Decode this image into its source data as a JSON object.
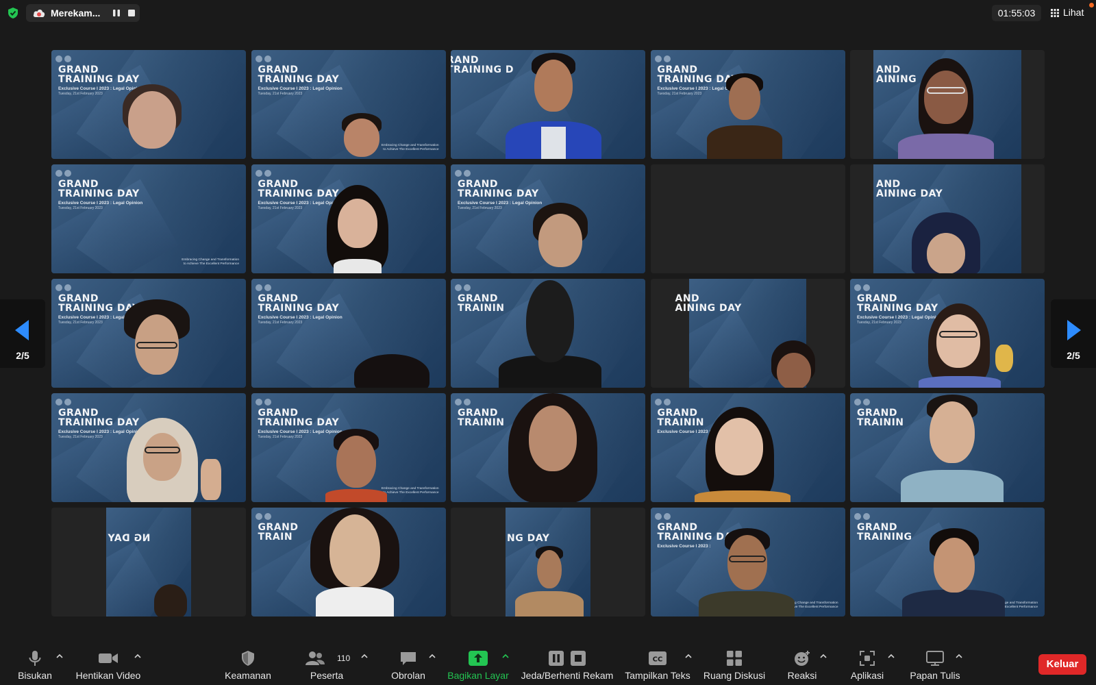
{
  "topbar": {
    "recording_label": "Merekam...",
    "timer": "01:55:03",
    "view_label": "Lihat"
  },
  "banner": {
    "line1": "GRAND",
    "line2": "TRAINING DAY",
    "line3": "Exclusive Course I 2023 : Legal Opinion",
    "line4": "Tuesday, 21st February 2023",
    "tagline1": "Embracing Change and Transformation",
    "tagline2": "to Achieve The Excellent Performance"
  },
  "navigation": {
    "left_page": "2/5",
    "right_page": "2/5"
  },
  "toolbar": {
    "mute_label": "Bisukan",
    "video_label": "Hentikan Video",
    "security_label": "Keamanan",
    "participants_label": "Peserta",
    "participants_count": "110",
    "chat_label": "Obrolan",
    "share_label": "Bagikan Layar",
    "record_label": "Jeda/Berhenti Rekam",
    "captions_label": "Tampilkan Teks",
    "breakout_label": "Ruang Diskusi",
    "reactions_label": "Reaksi",
    "apps_label": "Aplikasi",
    "whiteboard_label": "Papan Tulis",
    "leave_label": "Keluar"
  },
  "colors": {
    "accent_green": "#23c552",
    "leave_red": "#e02828",
    "nav_blue": "#2d8cff",
    "record_red": "#e54c4c"
  }
}
